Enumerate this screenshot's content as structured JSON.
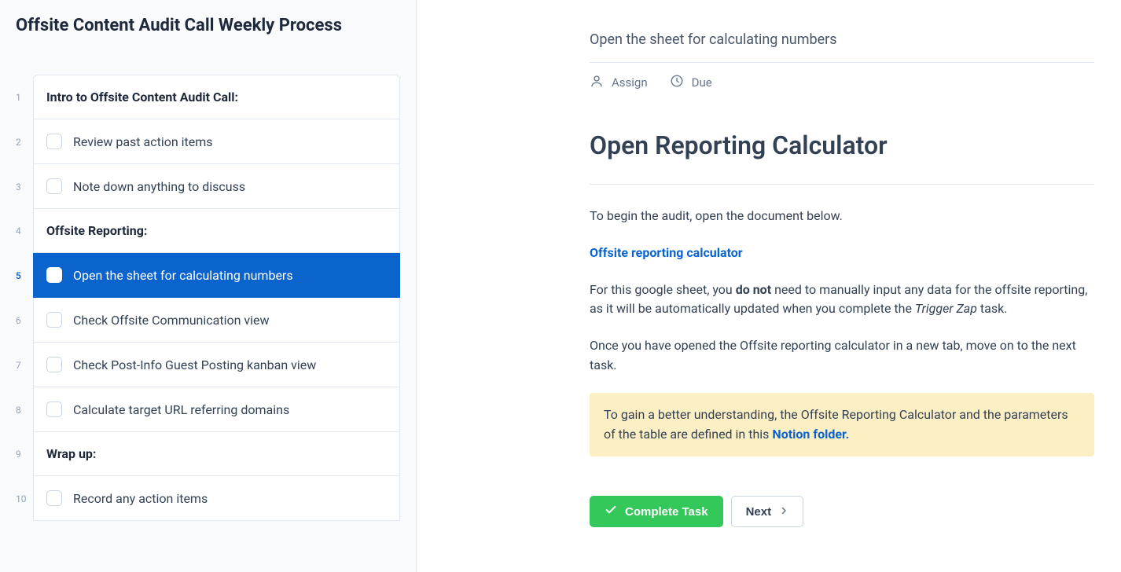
{
  "sidebar": {
    "title": "Offsite Content Audit Call Weekly Process",
    "steps": [
      {
        "num": "1",
        "type": "section",
        "label": "Intro to Offsite Content Audit Call:",
        "active": false
      },
      {
        "num": "2",
        "type": "task",
        "label": "Review past action items",
        "active": false
      },
      {
        "num": "3",
        "type": "task",
        "label": "Note down anything to discuss",
        "active": false
      },
      {
        "num": "4",
        "type": "section",
        "label": "Offsite Reporting:",
        "active": false
      },
      {
        "num": "5",
        "type": "task",
        "label": "Open the sheet for calculating numbers",
        "active": true
      },
      {
        "num": "6",
        "type": "task",
        "label": "Check Offsite Communication view",
        "active": false
      },
      {
        "num": "7",
        "type": "task",
        "label": "Check Post-Info Guest Posting kanban view",
        "active": false
      },
      {
        "num": "8",
        "type": "task",
        "label": "Calculate target URL referring domains",
        "active": false
      },
      {
        "num": "9",
        "type": "section",
        "label": "Wrap up:",
        "active": false
      },
      {
        "num": "10",
        "type": "task",
        "label": "Record any action items",
        "active": false
      }
    ]
  },
  "main": {
    "subtitle": "Open the sheet for calculating numbers",
    "meta": {
      "assign": "Assign",
      "due": "Due"
    },
    "heading": "Open Reporting Calculator",
    "intro": "To begin the audit, open the document below.",
    "link_text": "Offsite reporting calculator",
    "p2_a": "For this google sheet, you ",
    "p2_b": "do not",
    "p2_c": " need to manually input any data for the offsite reporting, as it will be automatically updated when you complete the ",
    "p2_d": "Trigger Zap",
    "p2_e": " task.",
    "p3": "Once you have opened the Offsite reporting calculator in a new tab, move on to the next task.",
    "callout_a": "To gain a better understanding, the Offsite Reporting Calculator and the parameters of the table are defined in this ",
    "callout_link": "Notion folder.",
    "actions": {
      "complete": "Complete Task",
      "next": "Next"
    }
  }
}
